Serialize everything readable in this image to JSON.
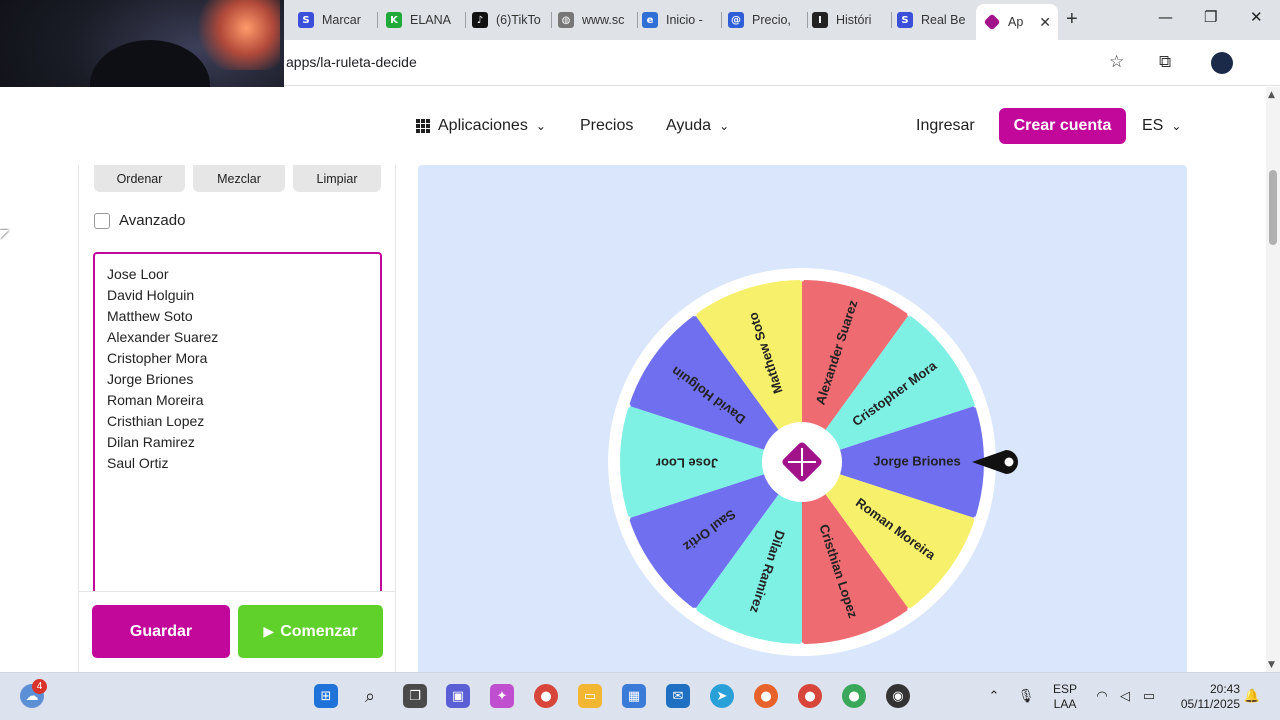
{
  "browser": {
    "tabs": [
      {
        "label": "Marcar",
        "fav_color": "#3b4fd8",
        "fav_glyph": "S"
      },
      {
        "label": "ELANA",
        "fav_color": "#1faa3a",
        "fav_glyph": "K"
      },
      {
        "label": "(6)TikTo",
        "fav_color": "#111111",
        "fav_glyph": "♪"
      },
      {
        "label": "www.sc",
        "fav_color": "#777777",
        "fav_glyph": "◍"
      },
      {
        "label": "Inicio -",
        "fav_color": "#2f6fd6",
        "fav_glyph": "e"
      },
      {
        "label": "Precio,",
        "fav_color": "#2f5fd6",
        "fav_glyph": "@"
      },
      {
        "label": "Históri",
        "fav_color": "#222222",
        "fav_glyph": "I"
      },
      {
        "label": "Real Be",
        "fav_color": "#3b4fd8",
        "fav_glyph": "S"
      }
    ],
    "active_tab": {
      "label": "Ap",
      "fav_color": "#a2138a"
    },
    "url": "apps/la-ruleta-decide"
  },
  "header": {
    "nav": {
      "apps": "Aplicaciones",
      "pricing": "Precios",
      "help": "Ayuda"
    },
    "login": "Ingresar",
    "create_account": "Crear cuenta",
    "language": "ES"
  },
  "panel": {
    "sort_label": "Ordenar",
    "shuffle_label": "Mezclar",
    "clear_label": "Limpiar",
    "advanced_label": "Avanzado",
    "names": [
      "Jose Loor",
      "David Holguin",
      "Matthew Soto",
      "Alexander Suarez",
      "Cristopher Mora",
      "Jorge Briones",
      "Roman Moreira",
      "Cristhian Lopez",
      "Dilan Ramirez",
      "Saul Ortiz"
    ],
    "save_label": "Guardar",
    "start_label": "Comenzar"
  },
  "wheel": {
    "segments": [
      {
        "name": "Jorge Briones",
        "color": "#6f6ff0"
      },
      {
        "name": "Roman Moreira",
        "color": "#f7f06a"
      },
      {
        "name": "Cristhian Lopez",
        "color": "#ee6b72"
      },
      {
        "name": "Dilan Ramirez",
        "color": "#7ef0e4"
      },
      {
        "name": "Saul Ortiz",
        "color": "#6f6ff0"
      },
      {
        "name": "Jose Loor",
        "color": "#7ef0e4"
      },
      {
        "name": "David Holguin",
        "color": "#6f6ff0"
      },
      {
        "name": "Matthew Soto",
        "color": "#f7f06a"
      },
      {
        "name": "Alexander Suarez",
        "color": "#ee6b72"
      },
      {
        "name": "Cristopher Mora",
        "color": "#7ef0e4"
      }
    ],
    "center_color": "#a2138a"
  },
  "taskbar": {
    "weather_badge": "4",
    "lang_line1": "ESP",
    "lang_line2": "LAA",
    "time": "20:43",
    "date": "05/11/2025"
  }
}
